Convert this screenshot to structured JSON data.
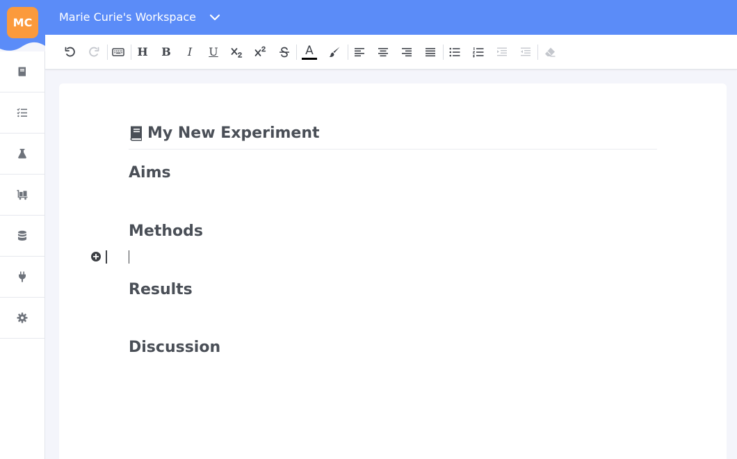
{
  "workspace": {
    "avatar_initials": "MC",
    "title": "Marie Curie's Workspace",
    "chevron_icon": "chevron-down-icon",
    "accent_color": "#5b8cf8",
    "avatar_color": "#fb9a3c"
  },
  "sidebar": {
    "items": [
      {
        "name": "notebook",
        "icon": "book-icon"
      },
      {
        "name": "tasks",
        "icon": "checklist-icon"
      },
      {
        "name": "experiments",
        "icon": "flask-icon"
      },
      {
        "name": "inventory",
        "icon": "cart-icon"
      },
      {
        "name": "database",
        "icon": "database-icon"
      },
      {
        "name": "integrations",
        "icon": "plug-icon"
      },
      {
        "name": "settings",
        "icon": "gear-icon"
      }
    ]
  },
  "toolbar": {
    "heading_label": "H",
    "bold_label": "B",
    "italic_label": "I",
    "underline_label": "U",
    "text_color_label": "A",
    "buttons": [
      "undo",
      "redo",
      "keyboard",
      "heading",
      "bold",
      "italic",
      "underline",
      "subscript",
      "superscript",
      "strikethrough",
      "text-color",
      "highlight",
      "align-left",
      "align-center",
      "align-right",
      "align-justify",
      "bullet-list",
      "numbered-list",
      "indent",
      "outdent",
      "clear-formatting"
    ],
    "disabled": [
      "redo",
      "indent",
      "outdent",
      "clear-formatting"
    ]
  },
  "document": {
    "title": "My New Experiment",
    "sections": [
      "Aims",
      "Methods",
      "Results",
      "Discussion"
    ]
  }
}
